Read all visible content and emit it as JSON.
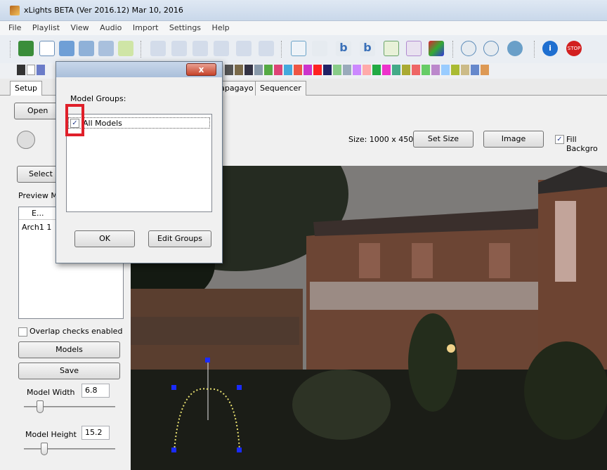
{
  "window": {
    "title": "xLights BETA (Ver 2016.12) Mar 10, 2016"
  },
  "menu": [
    "File",
    "Playlist",
    "View",
    "Audio",
    "Import",
    "Settings",
    "Help"
  ],
  "toolbar_icons": [
    "check-icon",
    "new-file-icon",
    "open-folder-icon",
    "save-icon",
    "save-as-icon",
    "render-icon",
    "play-icon",
    "pause-icon",
    "stop-icon",
    "rewind-icon",
    "forward-icon",
    "replay-icon",
    "triangle-icon",
    "sparkle-icon",
    "letter-b-icon",
    "letter-b-icon",
    "triangle-icon",
    "house-icon",
    "effects-icon",
    "zoom-in-icon",
    "zoom-out-icon",
    "gear-icon",
    "info-icon",
    "stop-sign-icon"
  ],
  "tabs": [
    "Setup",
    "Papagayo",
    "Sequencer"
  ],
  "left": {
    "open_button": "Open",
    "select_button": "Select",
    "preview_label": "Preview M",
    "list_header": "E...",
    "list_row": "Arch1  1",
    "overlap_label": "Overlap checks enabled",
    "models_button": "Models",
    "save_button": "Save",
    "model_width_label": "Model Width",
    "model_width_value": "6.8",
    "model_height_label": "Model Height",
    "model_height_value": "15.2"
  },
  "right": {
    "size_label": "Size: 1000 x 450",
    "set_size_button": "Set Size",
    "image_button": "Image",
    "fill_background_label": "Fill Backgro"
  },
  "dialog": {
    "close_label": "x",
    "group_label": "Model Groups:",
    "item_label": "All Models",
    "ok_button": "OK",
    "edit_groups_button": "Edit Groups"
  },
  "colors": {
    "highlight": "#e0202a",
    "handle": "#1a2bff",
    "arch": "#e8e070"
  }
}
